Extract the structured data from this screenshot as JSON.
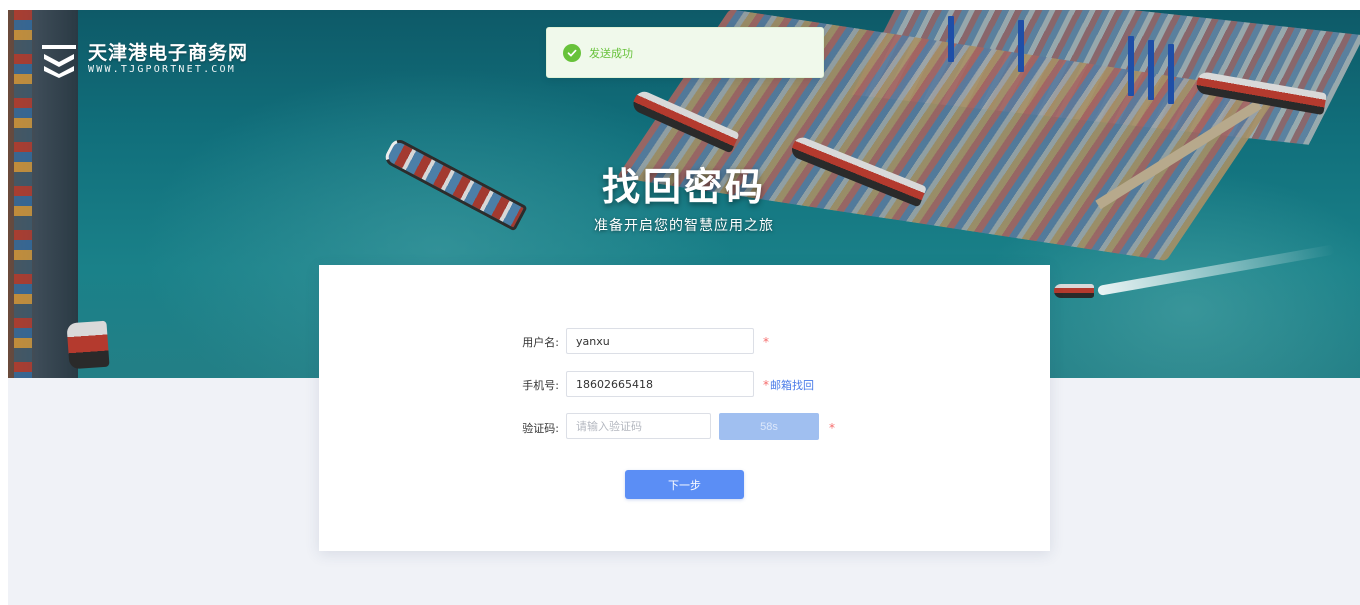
{
  "brand": {
    "name": "天津港电子商务网",
    "url": "WWW.TJGPORTNET.COM"
  },
  "toast": {
    "message": "发送成功",
    "color": "#67c23a"
  },
  "hero": {
    "title": "找回密码",
    "subtitle": "准备开启您的智慧应用之旅"
  },
  "form": {
    "username": {
      "label": "用户名:",
      "value": "yanxu",
      "required_mark": "*"
    },
    "phone": {
      "label": "手机号:",
      "value": "18602665418",
      "required_mark": "*",
      "alt_link": "邮箱找回"
    },
    "code": {
      "label": "验证码:",
      "value": "",
      "placeholder": "请输入验证码",
      "countdown": "58s",
      "required_mark": "*"
    },
    "next_button": "下一步"
  },
  "colors": {
    "primary": "#5b8ef5",
    "disabled_button": "#a0bff0",
    "required": "#f56c6c",
    "link": "#4a7be8",
    "page_background": "#f0f2f7"
  }
}
